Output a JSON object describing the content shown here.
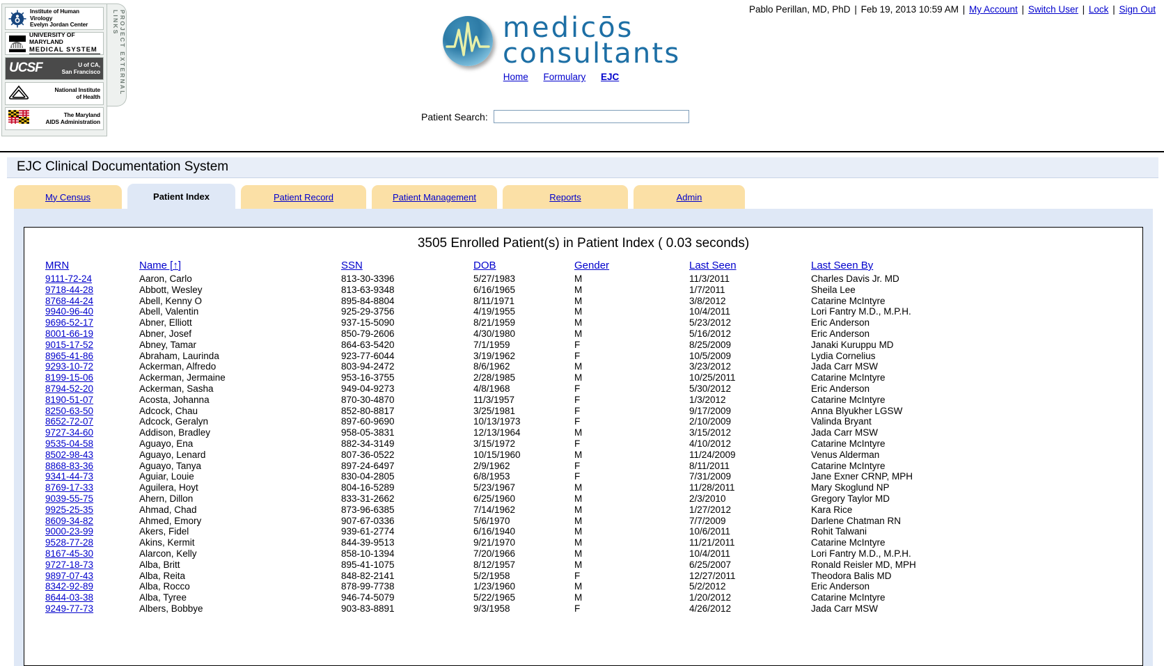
{
  "userbar": {
    "user": "Pablo Perillan, MD, PhD",
    "datetime": "Feb 19, 2013 10:59 AM",
    "my_account": "My Account",
    "switch_user": "Switch User",
    "lock": "Lock",
    "sign_out": "Sign Out",
    "sep": "|"
  },
  "external_links": {
    "tab_label": "PROJECT EXTERNAL LINKS",
    "items": [
      {
        "name": "institute-of-human-virology",
        "line1": "Institute of Human Virology",
        "line2": "Evelyn Jordan Center"
      },
      {
        "name": "university-of-maryland-medical-system",
        "line1": "UNIVERSITY OF MARYLAND",
        "line2": "MEDICAL SYSTEM"
      },
      {
        "name": "ucsf",
        "line1": "U of CA,",
        "line2": "San Francisco",
        "wordmark": "UCSF"
      },
      {
        "name": "national-institute-of-health",
        "line1": "National Institute",
        "line2": "of Health"
      },
      {
        "name": "maryland-aids-administration",
        "line1": "The Maryland",
        "line2": "AIDS Administration"
      }
    ]
  },
  "brand": {
    "line1": "medicōs",
    "line2": "consultants"
  },
  "nav": {
    "items": [
      {
        "label": "Home",
        "current": false
      },
      {
        "label": "Formulary",
        "current": false
      },
      {
        "label": "EJC",
        "current": true
      }
    ]
  },
  "search": {
    "label": "Patient Search:",
    "value": "",
    "placeholder": ""
  },
  "app": {
    "title": "EJC Clinical Documentation System"
  },
  "tabs": [
    {
      "label": "My Census",
      "active": false
    },
    {
      "label": "Patient Index",
      "active": true
    },
    {
      "label": "Patient Record",
      "active": false
    },
    {
      "label": "Patient Management",
      "active": false
    },
    {
      "label": "Reports",
      "active": false
    },
    {
      "label": "Admin",
      "active": false
    }
  ],
  "results": {
    "title": "3505 Enrolled Patient(s) in Patient Index ( 0.03 seconds)",
    "count": 3505,
    "seconds": "0.03",
    "columns": [
      {
        "key": "mrn",
        "label": "MRN",
        "sorted": false
      },
      {
        "key": "name",
        "label": "Name [↑]",
        "sorted": true
      },
      {
        "key": "ssn",
        "label": "SSN",
        "sorted": false
      },
      {
        "key": "dob",
        "label": "DOB",
        "sorted": false
      },
      {
        "key": "gender",
        "label": "Gender",
        "sorted": false
      },
      {
        "key": "last_seen",
        "label": "Last Seen",
        "sorted": false
      },
      {
        "key": "last_seen_by",
        "label": "Last Seen By",
        "sorted": false
      }
    ],
    "rows": [
      {
        "mrn": "9111-72-24",
        "name": "Aaron, Carlo",
        "ssn": "813-30-3396",
        "dob": "5/27/1983",
        "gender": "M",
        "last_seen": "11/3/2011",
        "last_seen_by": "Charles Davis Jr. MD"
      },
      {
        "mrn": "9718-44-28",
        "name": "Abbott, Wesley",
        "ssn": "813-63-9348",
        "dob": "6/16/1965",
        "gender": "M",
        "last_seen": "1/7/2011",
        "last_seen_by": "Sheila Lee"
      },
      {
        "mrn": "8768-44-24",
        "name": "Abell, Kenny O",
        "ssn": "895-84-8804",
        "dob": "8/11/1971",
        "gender": "M",
        "last_seen": "3/8/2012",
        "last_seen_by": "Catarine McIntyre"
      },
      {
        "mrn": "9940-96-40",
        "name": "Abell, Valentin",
        "ssn": "925-29-3756",
        "dob": "4/19/1955",
        "gender": "M",
        "last_seen": "10/4/2011",
        "last_seen_by": "Lori Fantry M.D., M.P.H."
      },
      {
        "mrn": "9696-52-17",
        "name": "Abner, Elliott",
        "ssn": "937-15-5090",
        "dob": "8/21/1959",
        "gender": "M",
        "last_seen": "5/23/2012",
        "last_seen_by": "Eric Anderson"
      },
      {
        "mrn": "8001-66-19",
        "name": "Abner, Josef",
        "ssn": "850-79-2606",
        "dob": "4/30/1980",
        "gender": "M",
        "last_seen": "5/16/2012",
        "last_seen_by": "Eric Anderson"
      },
      {
        "mrn": "9015-17-52",
        "name": "Abney, Tamar",
        "ssn": "864-63-5420",
        "dob": "7/1/1959",
        "gender": "F",
        "last_seen": "8/25/2009",
        "last_seen_by": "Janaki Kuruppu MD"
      },
      {
        "mrn": "8965-41-86",
        "name": "Abraham, Laurinda",
        "ssn": "923-77-6044",
        "dob": "3/19/1962",
        "gender": "F",
        "last_seen": "10/5/2009",
        "last_seen_by": "Lydia Cornelius"
      },
      {
        "mrn": "9293-10-72",
        "name": "Ackerman, Alfredo",
        "ssn": "803-94-2472",
        "dob": "8/6/1962",
        "gender": "M",
        "last_seen": "3/23/2012",
        "last_seen_by": "Jada Carr MSW"
      },
      {
        "mrn": "8199-15-06",
        "name": "Ackerman, Jermaine",
        "ssn": "953-16-3755",
        "dob": "2/28/1985",
        "gender": "M",
        "last_seen": "10/25/2011",
        "last_seen_by": "Catarine McIntyre"
      },
      {
        "mrn": "8794-52-20",
        "name": "Ackerman, Sasha",
        "ssn": "949-04-9273",
        "dob": "4/8/1968",
        "gender": "F",
        "last_seen": "5/30/2012",
        "last_seen_by": "Eric Anderson"
      },
      {
        "mrn": "8190-51-07",
        "name": "Acosta, Johanna",
        "ssn": "870-30-4870",
        "dob": "11/3/1957",
        "gender": "F",
        "last_seen": "1/3/2012",
        "last_seen_by": "Catarine McIntyre"
      },
      {
        "mrn": "8250-63-50",
        "name": "Adcock, Chau",
        "ssn": "852-80-8817",
        "dob": "3/25/1981",
        "gender": "F",
        "last_seen": "9/17/2009",
        "last_seen_by": "Anna Blyukher LGSW"
      },
      {
        "mrn": "8652-72-07",
        "name": "Adcock, Geralyn",
        "ssn": "897-60-9690",
        "dob": "10/13/1973",
        "gender": "F",
        "last_seen": "2/10/2009",
        "last_seen_by": "Valinda Bryant"
      },
      {
        "mrn": "9727-34-60",
        "name": "Addison, Bradley",
        "ssn": "958-05-3831",
        "dob": "12/13/1964",
        "gender": "M",
        "last_seen": "3/15/2012",
        "last_seen_by": "Jada Carr MSW"
      },
      {
        "mrn": "9535-04-58",
        "name": "Aguayo, Ena",
        "ssn": "882-34-3149",
        "dob": "3/15/1972",
        "gender": "F",
        "last_seen": "4/10/2012",
        "last_seen_by": "Catarine McIntyre"
      },
      {
        "mrn": "8502-98-43",
        "name": "Aguayo, Lenard",
        "ssn": "807-36-0522",
        "dob": "10/15/1960",
        "gender": "M",
        "last_seen": "11/24/2009",
        "last_seen_by": "Venus Alderman"
      },
      {
        "mrn": "8868-83-36",
        "name": "Aguayo, Tanya",
        "ssn": "897-24-6497",
        "dob": "2/9/1962",
        "gender": "F",
        "last_seen": "8/11/2011",
        "last_seen_by": "Catarine McIntyre"
      },
      {
        "mrn": "9341-44-73",
        "name": "Aguiar, Louie",
        "ssn": "830-04-2805",
        "dob": "6/8/1953",
        "gender": "F",
        "last_seen": "7/31/2009",
        "last_seen_by": "Jane Exner CRNP, MPH"
      },
      {
        "mrn": "8769-17-33",
        "name": "Aguilera, Hoyt",
        "ssn": "804-16-5289",
        "dob": "5/23/1967",
        "gender": "M",
        "last_seen": "11/28/2011",
        "last_seen_by": "Mary Skoglund NP"
      },
      {
        "mrn": "9039-55-75",
        "name": "Ahern, Dillon",
        "ssn": "833-31-2662",
        "dob": "6/25/1960",
        "gender": "M",
        "last_seen": "2/3/2010",
        "last_seen_by": "Gregory Taylor MD"
      },
      {
        "mrn": "9925-25-35",
        "name": "Ahmad, Chad",
        "ssn": "873-96-6385",
        "dob": "7/14/1962",
        "gender": "M",
        "last_seen": "1/27/2012",
        "last_seen_by": "Kara Rice"
      },
      {
        "mrn": "8609-34-82",
        "name": "Ahmed, Emory",
        "ssn": "907-67-0336",
        "dob": "5/6/1970",
        "gender": "M",
        "last_seen": "7/7/2009",
        "last_seen_by": "Darlene Chatman RN"
      },
      {
        "mrn": "9000-23-99",
        "name": "Akers, Fidel",
        "ssn": "939-61-2774",
        "dob": "6/16/1940",
        "gender": "M",
        "last_seen": "10/6/2011",
        "last_seen_by": "Rohit Talwani"
      },
      {
        "mrn": "9528-77-28",
        "name": "Akins, Kermit",
        "ssn": "844-39-9513",
        "dob": "9/21/1970",
        "gender": "M",
        "last_seen": "11/21/2011",
        "last_seen_by": "Catarine McIntyre"
      },
      {
        "mrn": "8167-45-30",
        "name": "Alarcon, Kelly",
        "ssn": "858-10-1394",
        "dob": "7/20/1966",
        "gender": "M",
        "last_seen": "10/4/2011",
        "last_seen_by": "Lori Fantry M.D., M.P.H."
      },
      {
        "mrn": "9727-18-73",
        "name": "Alba, Britt",
        "ssn": "895-41-1075",
        "dob": "8/12/1957",
        "gender": "M",
        "last_seen": "6/25/2007",
        "last_seen_by": "Ronald Reisler MD, MPH"
      },
      {
        "mrn": "9897-07-43",
        "name": "Alba, Reita",
        "ssn": "848-82-2141",
        "dob": "5/2/1958",
        "gender": "F",
        "last_seen": "12/27/2011",
        "last_seen_by": "Theodora Balis MD"
      },
      {
        "mrn": "8342-92-89",
        "name": "Alba, Rocco",
        "ssn": "878-99-7738",
        "dob": "1/23/1960",
        "gender": "M",
        "last_seen": "5/2/2012",
        "last_seen_by": "Eric Anderson"
      },
      {
        "mrn": "8644-03-38",
        "name": "Alba, Tyree",
        "ssn": "946-74-5079",
        "dob": "5/22/1965",
        "gender": "M",
        "last_seen": "1/20/2012",
        "last_seen_by": "Catarine McIntyre"
      },
      {
        "mrn": "9249-77-73",
        "name": "Albers, Bobbye",
        "ssn": "903-83-8891",
        "dob": "9/3/1958",
        "gender": "F",
        "last_seen": "4/26/2012",
        "last_seen_by": "Jada Carr MSW"
      }
    ]
  }
}
